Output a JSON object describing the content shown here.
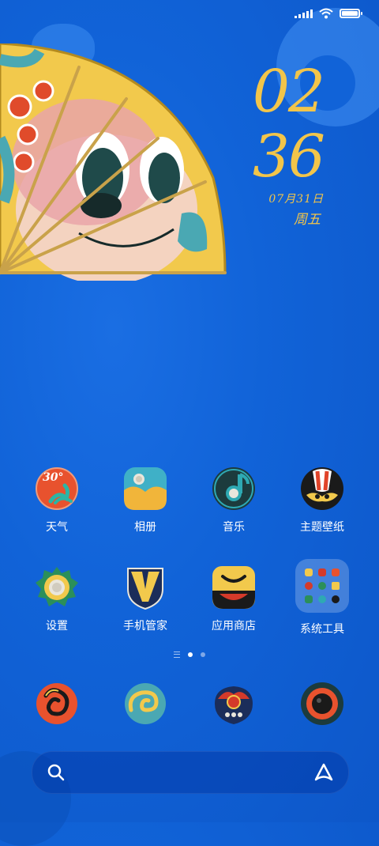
{
  "status_bar": {
    "signal_icon": "cellular-signal-icon",
    "wifi_icon": "wifi-icon",
    "battery_icon": "battery-icon",
    "battery_level": 1.0
  },
  "clock": {
    "hour": "02",
    "minute": "36",
    "date": "07月31日",
    "weekday": "周五",
    "color": "#f2c54a"
  },
  "apps": [
    {
      "label": "天气",
      "icon": "weather-icon",
      "badge": "30°"
    },
    {
      "label": "相册",
      "icon": "gallery-icon"
    },
    {
      "label": "音乐",
      "icon": "music-icon"
    },
    {
      "label": "主题壁纸",
      "icon": "themes-icon"
    },
    {
      "label": "设置",
      "icon": "settings-icon"
    },
    {
      "label": "手机管家",
      "icon": "security-icon"
    },
    {
      "label": "应用商店",
      "icon": "app-store-icon"
    },
    {
      "label": "系统工具",
      "icon": "folder-icon"
    }
  ],
  "dock": [
    {
      "icon": "phone-icon"
    },
    {
      "icon": "messages-icon"
    },
    {
      "icon": "browser-icon"
    },
    {
      "icon": "camera-icon"
    }
  ],
  "pager": {
    "pages": 2,
    "current": 1
  },
  "search_bar": {
    "search_icon": "search-icon",
    "assistant_icon": "assistant-icon"
  },
  "colors": {
    "wallpaper": "#1163d8",
    "accent": "#f2c54a"
  }
}
